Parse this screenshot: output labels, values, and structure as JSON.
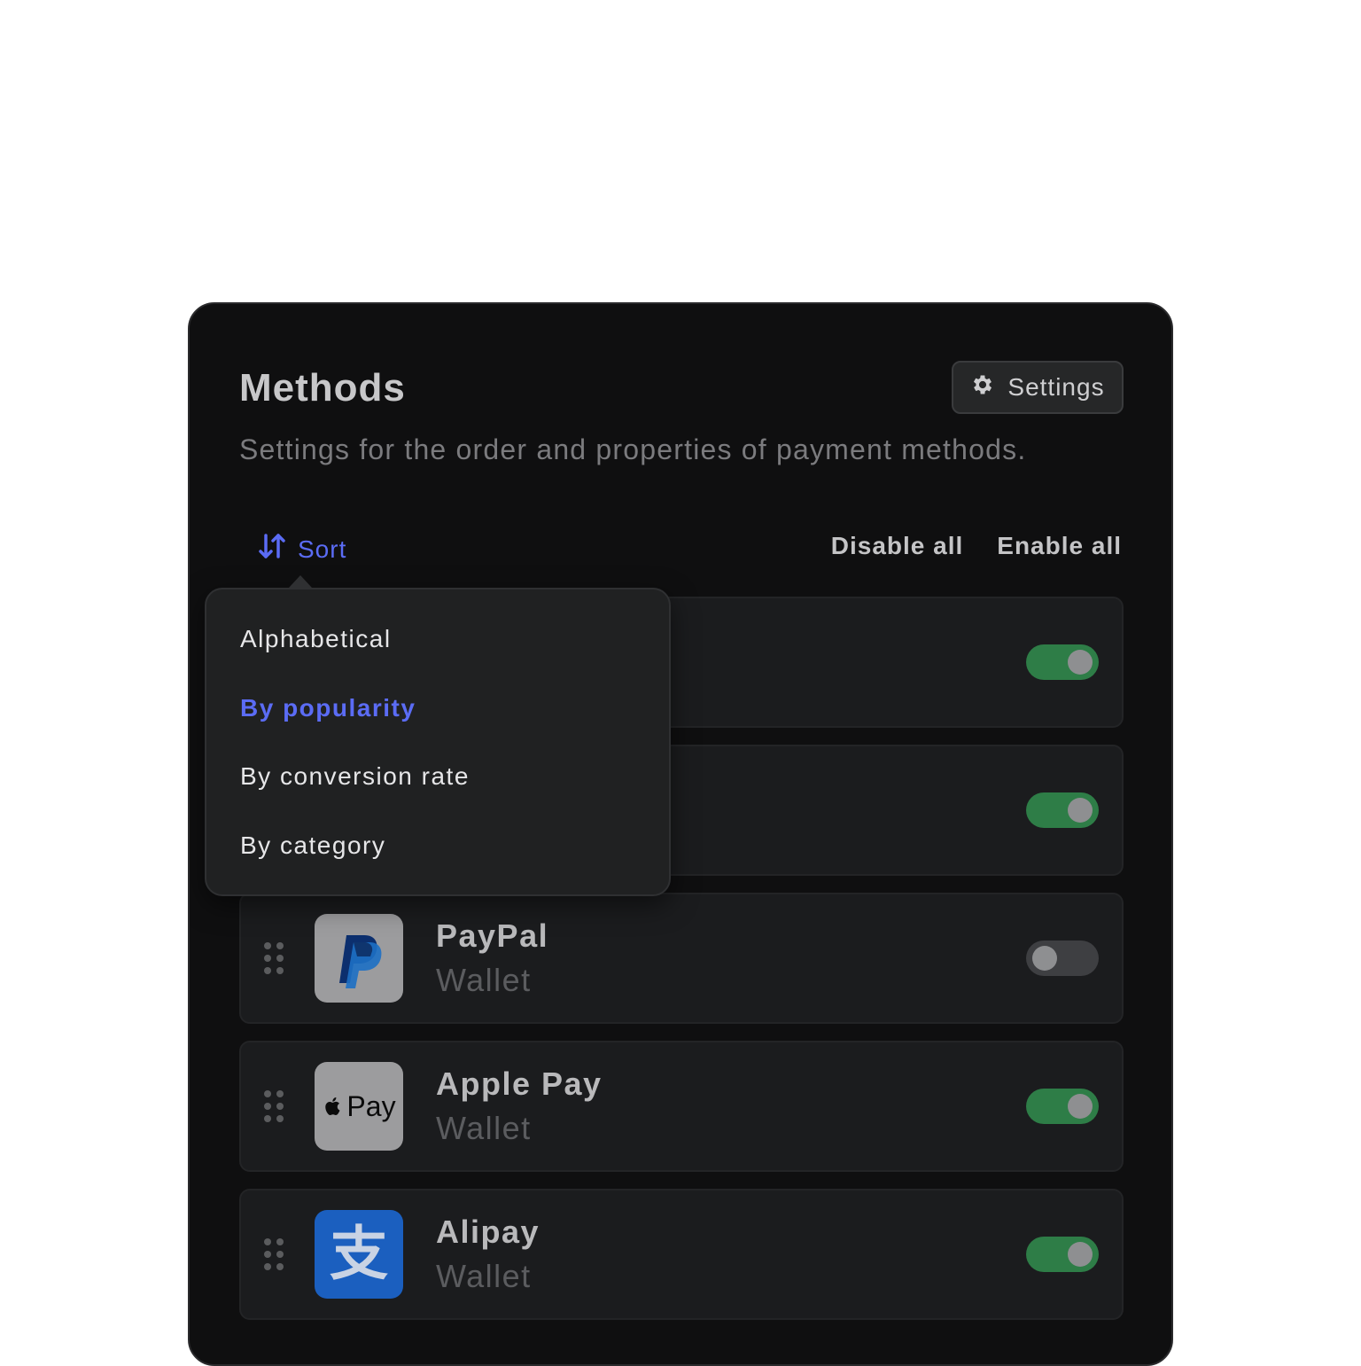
{
  "header": {
    "title": "Methods",
    "subtitle": "Settings for the order and properties of payment methods.",
    "settings_label": "Settings"
  },
  "toolbar": {
    "sort_label": "Sort",
    "disable_all_label": "Disable all",
    "enable_all_label": "Enable all"
  },
  "sort_menu": {
    "items": [
      {
        "label": "Alphabetical",
        "active": false
      },
      {
        "label": "By popularity",
        "active": true
      },
      {
        "label": "By conversion rate",
        "active": false
      },
      {
        "label": "By category",
        "active": false
      }
    ]
  },
  "methods": [
    {
      "name": "",
      "category": "",
      "enabled": true
    },
    {
      "name": "",
      "category": "",
      "enabled": true
    },
    {
      "name": "PayPal",
      "category": "Wallet",
      "enabled": false,
      "icon": "paypal-logo-icon"
    },
    {
      "name": "Apple Pay",
      "category": "Wallet",
      "enabled": true,
      "icon": "apple-pay-logo-icon",
      "logo_text": "Pay"
    },
    {
      "name": "Alipay",
      "category": "Wallet",
      "enabled": true,
      "icon": "alipay-logo-icon",
      "logo_text": "支"
    }
  ],
  "colors": {
    "accent": "#5b6cf5",
    "toggle_on": "#2e7d47",
    "toggle_off": "#3e3f42",
    "alipay_blue": "#1b5fbf"
  }
}
